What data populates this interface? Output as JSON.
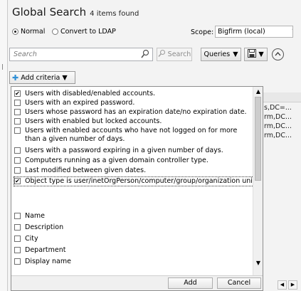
{
  "header": {
    "title": "Global Search",
    "count_text": "4 items found"
  },
  "mode": {
    "options": [
      "Normal",
      "Convert to LDAP"
    ],
    "selected": "Normal"
  },
  "scope": {
    "label": "Scope:",
    "value": "Bigfirm (local)"
  },
  "search": {
    "placeholder": "Search",
    "search_button": "Search",
    "queries_button": "Queries"
  },
  "add_criteria_label": "Add criteria",
  "results": {
    "cells": [
      "s,DC=...",
      "rm,DC...",
      "rm,DC...",
      "rm,DC..."
    ]
  },
  "criteria": {
    "items": [
      {
        "label": "Users with disabled/enabled accounts.",
        "checked": true
      },
      {
        "label": "Users with an expired password.",
        "checked": false
      },
      {
        "label": "Users whose password has an expiration date/no expiration date.",
        "checked": false
      },
      {
        "label": "Users with enabled but locked accounts.",
        "checked": false
      },
      {
        "label": "Users with enabled accounts who have not logged on for more than a given number of days.",
        "checked": false
      },
      {
        "label": "Users with a password expiring in a given number of days.",
        "checked": false
      },
      {
        "label": "Computers running as a given domain controller type.",
        "checked": false
      },
      {
        "label": "Last modified between given dates.",
        "checked": false
      },
      {
        "label": "Object type is user/inetOrgPerson/computer/group/organization unit.",
        "checked": true
      }
    ],
    "attributes": [
      {
        "label": "Name",
        "checked": false
      },
      {
        "label": "Description",
        "checked": false
      },
      {
        "label": "City",
        "checked": false
      },
      {
        "label": "Department",
        "checked": false
      },
      {
        "label": "Display name",
        "checked": false
      }
    ],
    "add_button": "Add",
    "cancel_button": "Cancel"
  }
}
